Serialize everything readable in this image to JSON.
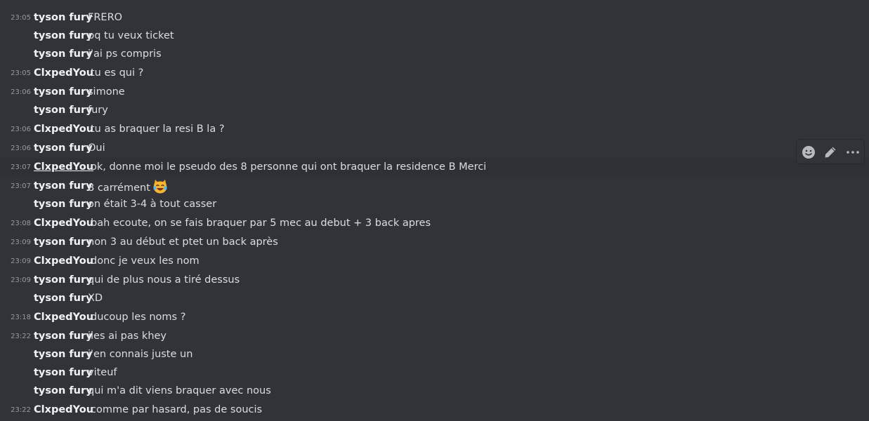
{
  "messages": [
    {
      "time": "23:05",
      "author": "tyson fury",
      "text": "FRERO"
    },
    {
      "time": "",
      "author": "tyson fury",
      "text": "pq tu veux ticket"
    },
    {
      "time": "",
      "author": "tyson fury",
      "text": "j'ai ps compris"
    },
    {
      "time": "23:05",
      "author": "ClxpedYou",
      "text": "tu es qui ?"
    },
    {
      "time": "23:06",
      "author": "tyson fury",
      "text": "simone"
    },
    {
      "time": "",
      "author": "tyson fury",
      "text": "fury"
    },
    {
      "time": "23:06",
      "author": "ClxpedYou",
      "text": "tu as braquer la resi B la ?"
    },
    {
      "time": "23:06",
      "author": "tyson fury",
      "text": "Oui"
    },
    {
      "time": "23:07",
      "author": "ClxpedYou",
      "text": "ok, donne moi le pseudo des 8 personne qui ont braquer la residence B Merci"
    },
    {
      "time": "23:07",
      "author": "tyson fury",
      "text": "8 carrément",
      "emoji": "joy-cat-emoji"
    },
    {
      "time": "",
      "author": "tyson fury",
      "text": "on était 3-4 à tout casser"
    },
    {
      "time": "23:08",
      "author": "ClxpedYou",
      "text": "bah ecoute, on se fais braquer par 5 mec au debut + 3 back apres"
    },
    {
      "time": "23:09",
      "author": "tyson fury",
      "text": "non 3 au début et ptet un back après"
    },
    {
      "time": "23:09",
      "author": "ClxpedYou",
      "text": "donc je veux les nom"
    },
    {
      "time": "23:09",
      "author": "tyson fury",
      "text": "qui de plus nous a tiré dessus"
    },
    {
      "time": "",
      "author": "tyson fury",
      "text": "XD"
    },
    {
      "time": "23:18",
      "author": "ClxpedYou",
      "text": "ducoup les noms ?"
    },
    {
      "time": "23:22",
      "author": "tyson fury",
      "text": "jles ai pas khey"
    },
    {
      "time": "",
      "author": "tyson fury",
      "text": "j'en connais juste un"
    },
    {
      "time": "",
      "author": "tyson fury",
      "text": "viteuf"
    },
    {
      "time": "",
      "author": "tyson fury",
      "text": "qui m'a dit viens braquer avec nous"
    },
    {
      "time": "23:22",
      "author": "ClxpedYou",
      "text": "comme par hasard, pas de soucis"
    }
  ],
  "toolbar": {
    "icons": [
      "add-reaction-icon",
      "edit-pencil-icon",
      "more-options-icon"
    ]
  },
  "colors": {
    "background": "#313338",
    "author": "#f2f3f5",
    "text": "#dbdee1",
    "timestamp": "#949ba4",
    "icon": "#b5bac1"
  }
}
